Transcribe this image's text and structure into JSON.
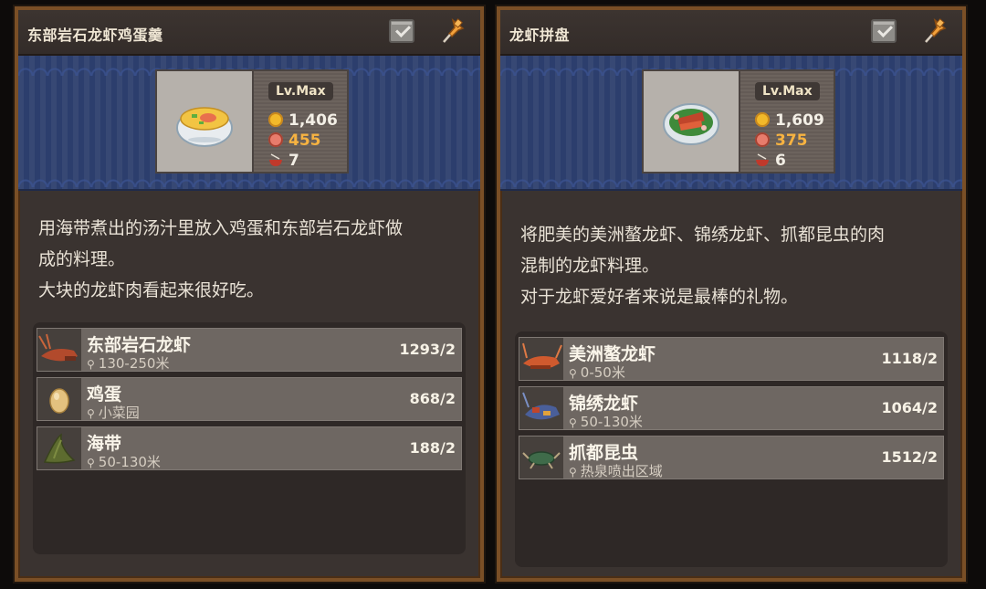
{
  "panels": [
    {
      "title": "东部岩石龙虾鸡蛋羹",
      "level": "Lv.Max",
      "coins": "1,406",
      "hearts": "455",
      "bowls": "7",
      "description": [
        "用海带煮出的汤汁里放入鸡蛋和东部岩石龙虾做",
        "成的料理。",
        "大块的龙虾肉看起来很好吃。"
      ],
      "ingredients": [
        {
          "name": "东部岩石龙虾",
          "location": "130-250米",
          "count": "1293/2",
          "icon": "lobster-icon"
        },
        {
          "name": "鸡蛋",
          "location": "小菜园",
          "count": "868/2",
          "icon": "egg-icon"
        },
        {
          "name": "海带",
          "location": "50-130米",
          "count": "188/2",
          "icon": "kelp-icon"
        }
      ]
    },
    {
      "title": "龙虾拼盘",
      "level": "Lv.Max",
      "coins": "1,609",
      "hearts": "375",
      "bowls": "6",
      "description": [
        "将肥美的美洲螯龙虾、锦绣龙虾、抓都昆虫的肉",
        "混制的龙虾料理。",
        "对于龙虾爱好者来说是最棒的礼物。"
      ],
      "ingredients": [
        {
          "name": "美洲螯龙虾",
          "location": "0-50米",
          "count": "1118/2",
          "icon": "lobster-icon"
        },
        {
          "name": "锦绣龙虾",
          "location": "50-130米",
          "count": "1064/2",
          "icon": "painted-lobster-icon"
        },
        {
          "name": "抓都昆虫",
          "location": "热泉喷出区域",
          "count": "1512/2",
          "icon": "bug-icon"
        }
      ]
    }
  ],
  "colors": {
    "panel_bg": "#3a3330",
    "frame": "#7a4f26",
    "banner": "#2c3e6d",
    "coin": "#f2b92a",
    "heart_value": "#f7b341"
  }
}
